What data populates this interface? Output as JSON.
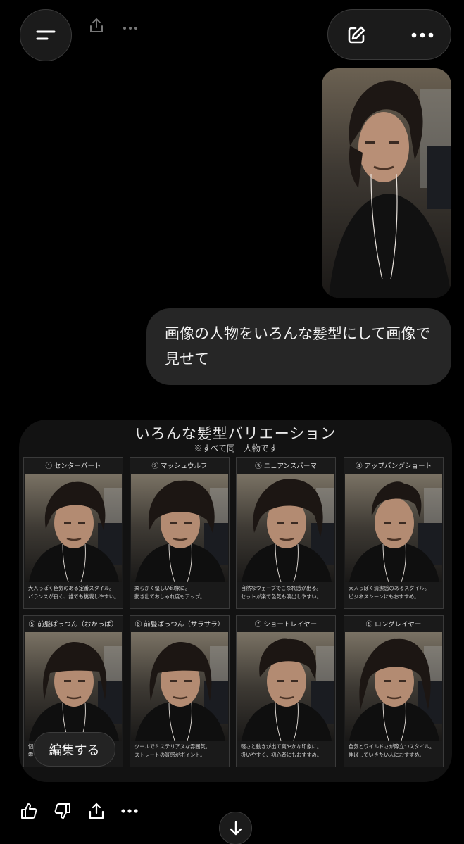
{
  "header": {
    "menu_icon": "menu-icon",
    "edit_icon": "compose-icon",
    "more_icon": "more-horizontal-icon"
  },
  "conversation": {
    "user_message": "画像の人物をいろんな髪型にして画像で見せて",
    "result": {
      "title": "いろんな髪型バリエーション",
      "subtitle": "※すべて同一人物です",
      "styles": [
        {
          "label": "① センターパート",
          "caption_1": "大人っぽく色気のある定番スタイル。",
          "caption_2": "バランスが良く、誰でも挑戦しやすい。"
        },
        {
          "label": "② マッシュウルフ",
          "caption_1": "柔らかく優しい印象に。",
          "caption_2": "動き出ておしゃれ度もアップ。"
        },
        {
          "label": "③ ニュアンスパーマ",
          "caption_1": "自然なウェーブでこなれ感が出る。",
          "caption_2": "セットが楽で色気も演出しやすい。"
        },
        {
          "label": "④ アップバングショート",
          "caption_1": "大人っぽく清潔感のあるスタイル。",
          "caption_2": "ビジネスシーンにもおすすめ。"
        },
        {
          "label": "⑤ 前髪ぱっつん（おかっぱ）",
          "caption_1": "個",
          "caption_2": "雰"
        },
        {
          "label": "⑥ 前髪ぱっつん（サラサラ）",
          "caption_1": "クールでミステリアスな雰囲気。",
          "caption_2": "ストレートの質感がポイント。"
        },
        {
          "label": "⑦ ショートレイヤー",
          "caption_1": "軽さと動きが出て爽やかな印象に。",
          "caption_2": "扱いやすく、初心者にもおすすめ。"
        },
        {
          "label": "⑧ ロングレイヤー",
          "caption_1": "色気とワイルドさが際立つスタイル。",
          "caption_2": "伸ばしていきたい人におすすめ。"
        }
      ],
      "edit_label": "編集する"
    }
  },
  "actions": {
    "like_icon": "thumbs-up-icon",
    "dislike_icon": "thumbs-down-icon",
    "share_icon": "share-icon",
    "more_icon": "more-horizontal-icon"
  },
  "scroll_icon": "arrow-down-icon"
}
